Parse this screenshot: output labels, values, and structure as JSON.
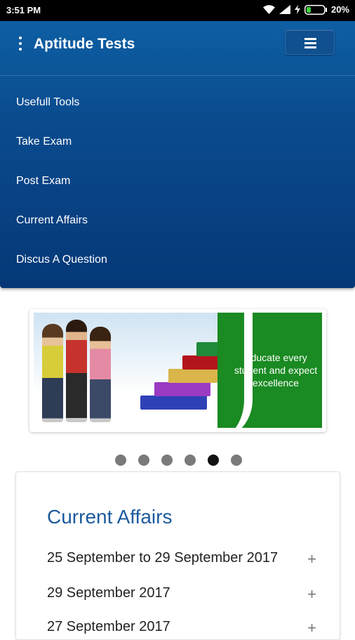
{
  "status_bar": {
    "time": "3:51 PM",
    "battery": "20%"
  },
  "header": {
    "title": "Aptitude Tests"
  },
  "nav": {
    "items": [
      {
        "label": "Usefull Tools"
      },
      {
        "label": "Take Exam"
      },
      {
        "label": "Post Exam"
      },
      {
        "label": "Current Affairs"
      },
      {
        "label": "Discus A Question"
      }
    ]
  },
  "banner": {
    "text": "Educate every student and expect excellence"
  },
  "carousel": {
    "total": 6,
    "active_index": 5
  },
  "current_affairs": {
    "title": "Current Affairs",
    "items": [
      {
        "label": "25 September to 29 September 2017",
        "icon": "+"
      },
      {
        "label": "29 September 2017",
        "icon": "+"
      },
      {
        "label": "27 September 2017",
        "icon": "+"
      }
    ]
  },
  "colors": {
    "nav_top": "#0e5fa4",
    "nav_bottom": "#063877",
    "title_blue": "#1b5a9e",
    "banner_green": "#1a8a22"
  }
}
